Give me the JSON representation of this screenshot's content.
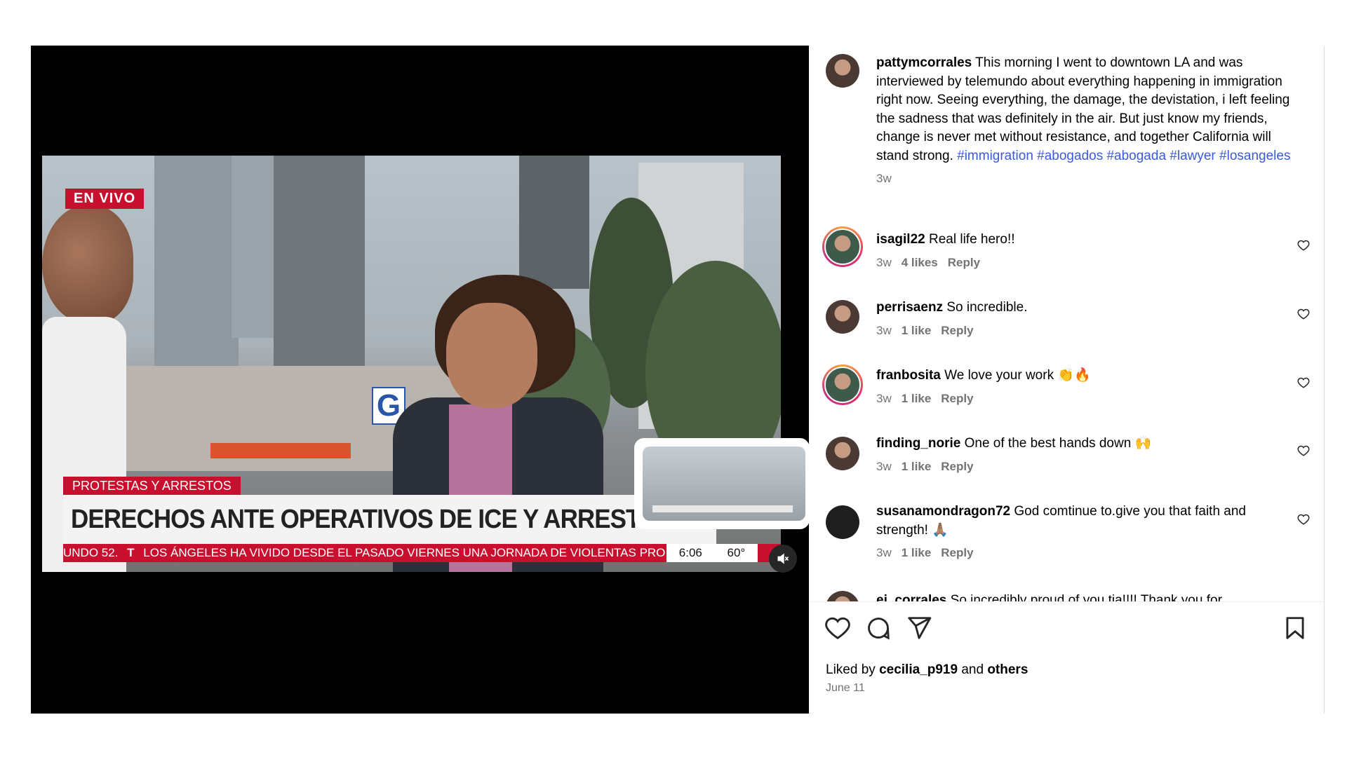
{
  "video": {
    "live_badge": "EN VIVO",
    "tag": "PROTESTAS Y ARRESTOS",
    "headline": "DERECHOS ANTE OPERATIVOS DE ICE Y ARRESTOS",
    "ticker_prefix": "UNDO 52.",
    "ticker_brand": "T",
    "ticker_text": "LOS ÁNGELES HA VIVIDO DESDE EL PASADO VIERNES UNA JORNADA DE VIOLENTAS PRO",
    "clock_time": "6:06",
    "clock_temp": "60°",
    "logo_letter": "G"
  },
  "caption": {
    "username": "pattymcorrales",
    "text": "This morning I went to downtown LA and was interviewed by telemundo about everything happening in immigration right now. Seeing everything, the damage, the devistation, i left feeling the sadness that was definitely in the air. But just know my friends, change is never met without resistance, and together California will stand strong.",
    "hashtags": "#immigration #abogados #abogada #lawyer #losangeles",
    "age": "3w"
  },
  "comments": [
    {
      "user": "isagil22",
      "text": "Real life hero!!",
      "age": "3w",
      "likes": "4 likes",
      "reply": "Reply"
    },
    {
      "user": "perrisaenz",
      "text": "So incredible.",
      "age": "3w",
      "likes": "1 like",
      "reply": "Reply"
    },
    {
      "user": "franbosita",
      "text": "We love your work 👏🔥",
      "age": "3w",
      "likes": "1 like",
      "reply": "Reply"
    },
    {
      "user": "finding_norie",
      "text": "One of the best hands down 🙌",
      "age": "3w",
      "likes": "1 like",
      "reply": "Reply"
    },
    {
      "user": "susanamondragon72",
      "text": "God comtinue to.give you that faith and strength! 🙏🏽",
      "age": "3w",
      "likes": "1 like",
      "reply": "Reply"
    },
    {
      "user": "ej_corrales",
      "text": "So incredibly proud of you tia!!!! Thank you for"
    }
  ],
  "footer": {
    "liked_prefix": "Liked by",
    "liked_user": "cecilia_p919",
    "liked_and": "and",
    "liked_others": "others",
    "date": "June 11"
  },
  "icons": {
    "like": "heart-icon",
    "comment": "comment-icon",
    "share": "send-icon",
    "save": "bookmark-icon",
    "mute": "muted-speaker-icon"
  }
}
